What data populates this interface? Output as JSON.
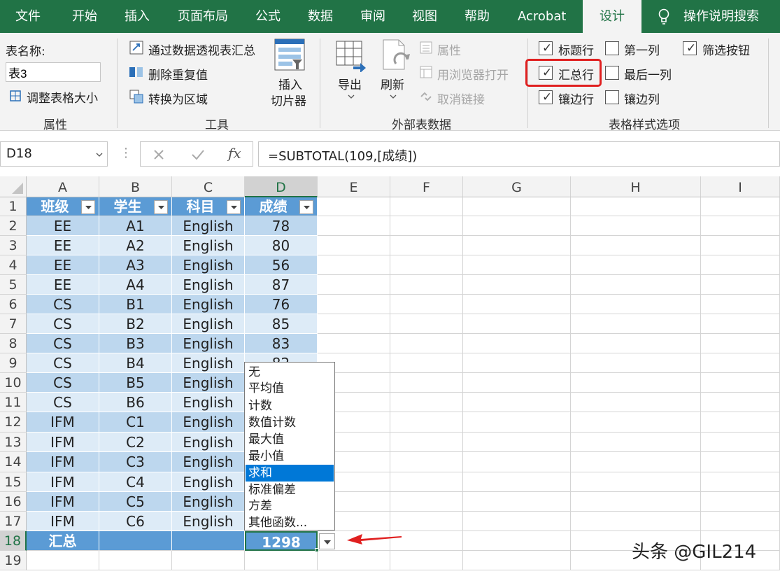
{
  "tabs": [
    "文件",
    "开始",
    "插入",
    "页面布局",
    "公式",
    "数据",
    "审阅",
    "视图",
    "帮助",
    "Acrobat",
    "设计",
    "操作说明搜索"
  ],
  "ribbon": {
    "properties": {
      "table_name_label": "表名称:",
      "table_name_value": "表3",
      "resize_label": "调整表格大小",
      "group": "属性"
    },
    "tools": {
      "pivot": "通过数据透视表汇总",
      "dedupe": "删除重复值",
      "convert": "转换为区域",
      "slicer_l1": "插入",
      "slicer_l2": "切片器",
      "group": "工具"
    },
    "external": {
      "export": "导出",
      "refresh": "刷新",
      "props": "属性",
      "browser": "用浏览器打开",
      "unlink": "取消链接",
      "group": "外部表数据"
    },
    "style_options": {
      "header_row": "标题行",
      "first_col": "第一列",
      "filter_btn": "筛选按钮",
      "total_row": "汇总行",
      "last_col": "最后一列",
      "banded_rows": "镶边行",
      "banded_cols": "镶边列",
      "group": "表格样式选项",
      "checked": {
        "header_row": true,
        "first_col": false,
        "filter_btn": true,
        "total_row": true,
        "last_col": false,
        "banded_rows": true,
        "banded_cols": false
      }
    }
  },
  "name_box": "D18",
  "formula": "=SUBTOTAL(109,[成绩])",
  "fx": "fx",
  "columns": [
    "A",
    "B",
    "C",
    "D",
    "E",
    "F",
    "G",
    "H",
    "I"
  ],
  "rows": [
    "1",
    "2",
    "3",
    "4",
    "5",
    "6",
    "7",
    "8",
    "9",
    "10",
    "11",
    "12",
    "13",
    "14",
    "15",
    "16",
    "17",
    "18",
    "19"
  ],
  "table": {
    "headers": [
      "班级",
      "学生",
      "科目",
      "成绩"
    ],
    "rows": [
      [
        "EE",
        "A1",
        "English",
        "78"
      ],
      [
        "EE",
        "A2",
        "English",
        "80"
      ],
      [
        "EE",
        "A3",
        "English",
        "56"
      ],
      [
        "EE",
        "A4",
        "English",
        "87"
      ],
      [
        "CS",
        "B1",
        "English",
        "76"
      ],
      [
        "CS",
        "B2",
        "English",
        "85"
      ],
      [
        "CS",
        "B3",
        "English",
        "83"
      ],
      [
        "CS",
        "B4",
        "English",
        "82"
      ],
      [
        "CS",
        "B5",
        "English",
        ""
      ],
      [
        "CS",
        "B6",
        "English",
        ""
      ],
      [
        "IFM",
        "C1",
        "English",
        ""
      ],
      [
        "IFM",
        "C2",
        "English",
        ""
      ],
      [
        "IFM",
        "C3",
        "English",
        ""
      ],
      [
        "IFM",
        "C4",
        "English",
        ""
      ],
      [
        "IFM",
        "C5",
        "English",
        ""
      ],
      [
        "IFM",
        "C6",
        "English",
        ""
      ]
    ],
    "total_label": "汇总",
    "total_value": "1298"
  },
  "dropdown": {
    "items": [
      "无",
      "平均值",
      "计数",
      "数值计数",
      "最大值",
      "最小值",
      "求和",
      "标准偏差",
      "方差",
      "其他函数..."
    ],
    "selected": "求和"
  },
  "watermark": "头条 @GIL214",
  "colors": {
    "excel_green": "#217346",
    "table_header": "#5b9bd5",
    "band_dark": "#bdd7ee",
    "band_light": "#ddebf7",
    "highlight": "#0078d7",
    "annotation": "#e02020"
  }
}
